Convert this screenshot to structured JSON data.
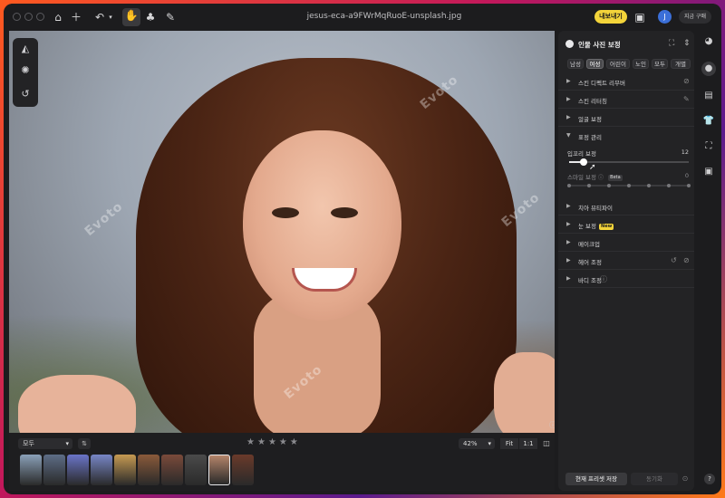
{
  "window": {
    "title": "jesus-eca-a9FWrMqRuoE-unsplash.jpg"
  },
  "topbar": {
    "export_label": "내보내기",
    "avatar_initial": "J",
    "buy_label": "지금 구매"
  },
  "canvas": {
    "watermark": "Evoto"
  },
  "filmstrip": {
    "filter_label": "모두",
    "sort_label": "⇅",
    "rating": 0,
    "zoom_label": "42%",
    "fit_label": "Fit",
    "one_to_one_label": "1:1",
    "thumbnails": [
      {
        "color": "#8aa0b8"
      },
      {
        "color": "#5d6d86"
      },
      {
        "color": "#6a74c8"
      },
      {
        "color": "#7786c6"
      },
      {
        "color": "#c69a52"
      },
      {
        "color": "#8a5a3a"
      },
      {
        "color": "#7a4a3a"
      },
      {
        "color": "#4a4a4a"
      },
      {
        "color": "#b4846a"
      },
      {
        "color": "#6a3a2a"
      }
    ]
  },
  "panel": {
    "title": "인물 사진 보정",
    "groups": [
      "남성",
      "여성",
      "어린이",
      "노인",
      "모두",
      "개별"
    ],
    "active_group": "여성",
    "sections_top": [
      {
        "label": "스킨 디펙트 리무버"
      },
      {
        "label": "스킨 리터칭"
      },
      {
        "label": "얼굴 보정"
      }
    ],
    "expression": {
      "label": "표정 관리",
      "slider1": {
        "label": "입꼬리 보정",
        "value": 12,
        "fraction": 0.12
      },
      "slider2": {
        "label": "스마일 보정",
        "badge": "Beta",
        "value": 0
      }
    },
    "sections_bottom": [
      {
        "label": "치아 뷰티파이"
      },
      {
        "label": "눈 보정",
        "badge": "New"
      },
      {
        "label": "메이크업"
      },
      {
        "label": "헤어 조정"
      },
      {
        "label": "바디 조정"
      }
    ],
    "save_preset_label": "현재 프리셋 저장",
    "sync_label": "동기화"
  }
}
